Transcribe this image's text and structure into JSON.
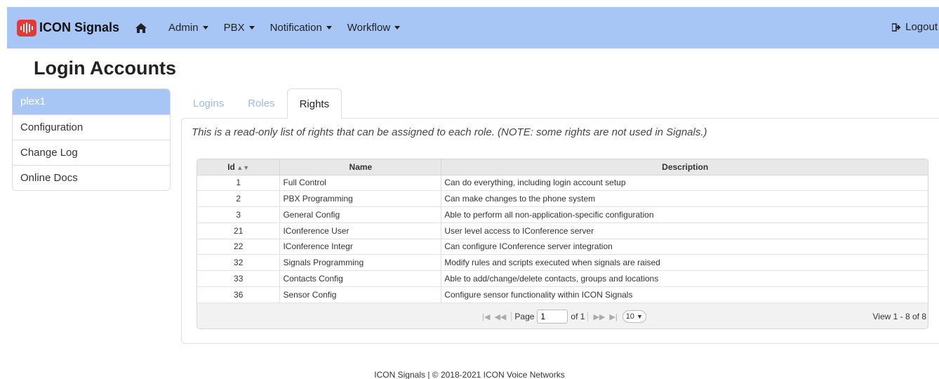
{
  "brand": {
    "name": "ICON Signals",
    "accent": "#a8c6f5",
    "logo_color": "#e53935"
  },
  "nav": {
    "items": [
      {
        "label": "Admin"
      },
      {
        "label": "PBX"
      },
      {
        "label": "Notification"
      },
      {
        "label": "Workflow"
      }
    ],
    "logout_label": "Logout"
  },
  "page_title": "Login Accounts",
  "sidebar": {
    "items": [
      {
        "label": "plex1",
        "active": true
      },
      {
        "label": "Configuration"
      },
      {
        "label": "Change Log"
      },
      {
        "label": "Online Docs"
      }
    ]
  },
  "tabs": [
    {
      "label": "Logins"
    },
    {
      "label": "Roles"
    },
    {
      "label": "Rights",
      "active": true
    }
  ],
  "note": "This is a read-only list of rights that can be assigned to each role. (NOTE: some rights are not used in Signals.)",
  "grid": {
    "columns": {
      "id": "Id",
      "name": "Name",
      "description": "Description"
    },
    "rows": [
      {
        "id": "1",
        "name": "Full Control",
        "description": "Can do everything, including login account setup"
      },
      {
        "id": "2",
        "name": "PBX Programming",
        "description": "Can make changes to the phone system"
      },
      {
        "id": "3",
        "name": "General Config",
        "description": "Able to perform all non-application-specific configuration"
      },
      {
        "id": "21",
        "name": "IConference User",
        "description": "User level access to IConference server"
      },
      {
        "id": "22",
        "name": "IConference Integr",
        "description": "Can configure IConference server integration"
      },
      {
        "id": "32",
        "name": "Signals Programming",
        "description": "Modify rules and scripts executed when signals are raised"
      },
      {
        "id": "33",
        "name": "Contacts Config",
        "description": "Able to add/change/delete contacts, groups and locations"
      },
      {
        "id": "36",
        "name": "Sensor Config",
        "description": "Configure sensor functionality within ICON Signals"
      }
    ]
  },
  "pager": {
    "page_label": "Page",
    "page_value": "1",
    "of_label": "of 1",
    "page_size": "10",
    "view_text": "View 1 - 8 of 8"
  },
  "footer": "ICON Signals | © 2018-2021 ICON Voice Networks"
}
